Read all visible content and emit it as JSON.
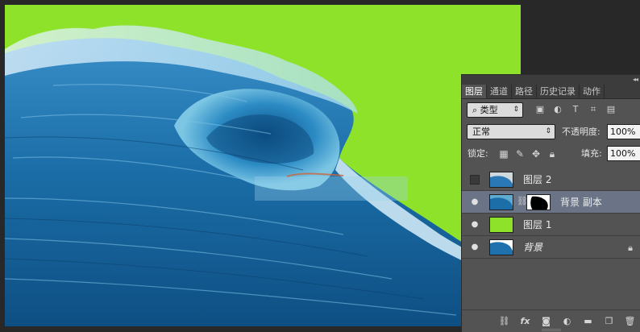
{
  "colors": {
    "canvas_bg": "#8ee22a",
    "panel_bg": "#535353",
    "selected_row": "#6a7486"
  },
  "tabs": [
    {
      "label": "图层",
      "active": true
    },
    {
      "label": "通道",
      "active": false
    },
    {
      "label": "路径",
      "active": false
    },
    {
      "label": "历史记录",
      "active": false
    },
    {
      "label": "动作",
      "active": false
    }
  ],
  "filter": {
    "search_glyph": "⌕",
    "kind_label": "类型"
  },
  "blend": {
    "mode": "正常",
    "opacity_label": "不透明度:",
    "opacity_value": "100%"
  },
  "lock": {
    "label": "锁定:",
    "fill_label": "填充:",
    "fill_value": "100%"
  },
  "layers": [
    {
      "name": "图层 2",
      "visible": false,
      "selected": false
    },
    {
      "name": "背景 副本",
      "visible": true,
      "selected": true,
      "has_mask": true
    },
    {
      "name": "图层 1",
      "visible": true,
      "selected": false,
      "fill": "#8ee22a"
    },
    {
      "name": "背景",
      "visible": true,
      "selected": false,
      "locked": true
    }
  ],
  "icons": {
    "collapse": "double-chevron-left-icon",
    "link": "link-icon",
    "fx": "fx",
    "mask": "add-mask-icon",
    "adjust": "adjustment-layer-icon",
    "group": "folder-icon",
    "new_layer": "new-layer-icon",
    "trash": "trash-icon"
  }
}
